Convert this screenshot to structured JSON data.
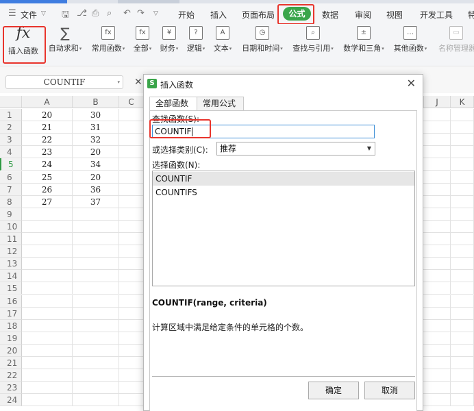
{
  "menu": {
    "file_icon": "hamburger-icon",
    "file": "文件",
    "tabs": [
      "开始",
      "插入",
      "页面布局",
      "公式",
      "数据",
      "审阅",
      "视图",
      "开发工具",
      "特"
    ],
    "active_tab": "公式"
  },
  "ribbon": {
    "buttons": [
      "插入函数",
      "自动求和",
      "常用函数",
      "全部",
      "财务",
      "逻辑",
      "文本",
      "日期和时间",
      "查找与引用",
      "数学和三角",
      "其他函数",
      "名称管理器"
    ],
    "icons": [
      "fx-icon",
      "sigma-icon",
      "common-func-icon",
      "all-func-icon",
      "finance-icon",
      "logic-icon",
      "text-icon",
      "datetime-icon",
      "lookup-icon",
      "math-icon",
      "more-func-icon",
      "name-manager-icon"
    ]
  },
  "formula_bar": {
    "name_box": "COUNTIF",
    "cancel_glyph": "✕"
  },
  "sheet": {
    "columns": [
      "A",
      "B",
      "C",
      "J",
      "K"
    ],
    "rows": [
      "1",
      "2",
      "3",
      "4",
      "5",
      "6",
      "7",
      "8",
      "9",
      "10",
      "11",
      "12",
      "13",
      "14",
      "15",
      "16",
      "17",
      "18",
      "19",
      "20",
      "21",
      "22",
      "23",
      "24"
    ],
    "selected_row": "5",
    "col_a": [
      "20",
      "21",
      "22",
      "23",
      "24",
      "25",
      "26",
      "27"
    ],
    "col_b": [
      "30",
      "31",
      "32",
      "20",
      "34",
      "20",
      "36",
      "37"
    ]
  },
  "dialog": {
    "title": "插入函数",
    "logo": "S",
    "tabs": [
      "全部函数",
      "常用公式"
    ],
    "search_label": "查找函数(S):",
    "search_value": "COUNTIF",
    "category_label": "或选择类别(C):",
    "category_value": "推荐",
    "select_label": "选择函数(N):",
    "functions": [
      "COUNTIF",
      "COUNTIFS"
    ],
    "signature": "COUNTIF(range, criteria)",
    "description": "计算区域中满足给定条件的单元格的个数。",
    "ok": "确定",
    "cancel": "取消"
  },
  "colors": {
    "accent_green": "#3aa54a",
    "highlight_red": "#e8342c",
    "focus_blue": "#3f8fd6"
  }
}
